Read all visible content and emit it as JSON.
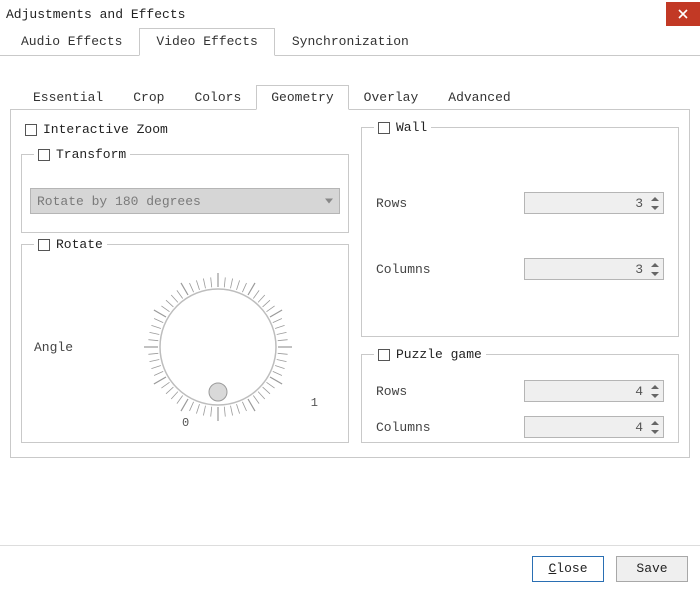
{
  "window": {
    "title": "Adjustments and Effects"
  },
  "main_tabs": {
    "audio": "Audio Effects",
    "video": "Video Effects",
    "sync": "Synchronization",
    "active": "video"
  },
  "sub_tabs": {
    "essential": "Essential",
    "crop": "Crop",
    "colors": "Colors",
    "geometry": "Geometry",
    "overlay": "Overlay",
    "advanced": "Advanced",
    "active": "geometry"
  },
  "geometry": {
    "interactive_zoom": {
      "label": "Interactive Zoom",
      "checked": false
    },
    "transform": {
      "label": "Transform",
      "checked": false,
      "selected": "Rotate by 180 degrees"
    },
    "rotate": {
      "label": "Rotate",
      "checked": false,
      "angle_label": "Angle",
      "dial_min": "0",
      "dial_one": "1"
    },
    "wall": {
      "label": "Wall",
      "checked": false,
      "rows_label": "Rows",
      "rows_value": "3",
      "cols_label": "Columns",
      "cols_value": "3"
    },
    "puzzle": {
      "label": "Puzzle game",
      "checked": false,
      "rows_label": "Rows",
      "rows_value": "4",
      "cols_label": "Columns",
      "cols_value": "4"
    }
  },
  "footer": {
    "close": "Close",
    "save": "Save"
  }
}
